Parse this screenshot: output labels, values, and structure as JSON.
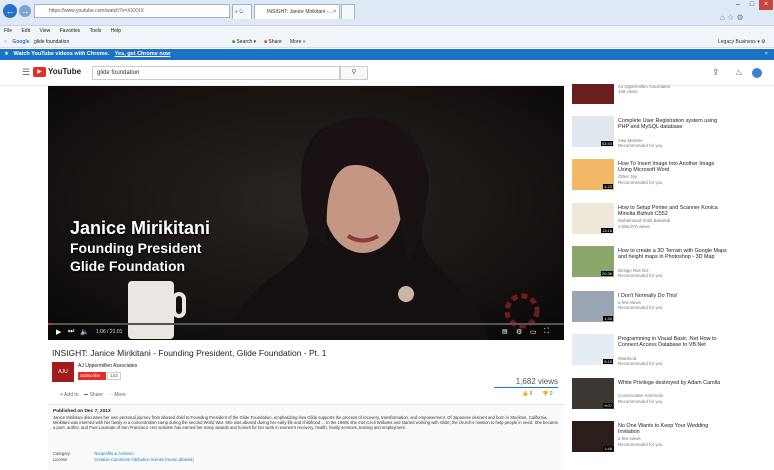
{
  "browser": {
    "url": "https://www.youtube.com/watch?v=XXXXX",
    "tab1_title": "INSIGHT: Janice Mirikitani -...",
    "menu": [
      "File",
      "Edit",
      "View",
      "Favorites",
      "Tools",
      "Help"
    ],
    "search_engine": "Google",
    "search_text": "glide foundation",
    "search_btn": "Search",
    "share_btn": "Share",
    "more_btn": "More",
    "signin": "Legacy Business"
  },
  "chrome_banner": {
    "text": "Watch YouTube videos with Chrome.",
    "link": "Yes, get Chrome now"
  },
  "youtube": {
    "logo": "YouTube",
    "search_value": "glide foundation"
  },
  "video": {
    "overlay_name": "Janice Mirikitani",
    "overlay_role1": "Founding President",
    "overlay_role2": "Glide Foundation",
    "time": "1:06 / 21:01",
    "title": "INSIGHT: Janice Mirikitani - Founding President, Glide Foundation - Pt. 1",
    "channel": "AJ Uppermillen Associates",
    "subscribe": "Subscribe",
    "sub_count": "103",
    "views": "1,682 views",
    "likes": "6",
    "dislikes": "0",
    "add_to": "Add to",
    "share": "Share",
    "more": "More",
    "published": "Published on Dec 7, 2013",
    "description": "Janice Mirikitani discusses her own personal journey from abused child to Founding President of the Glide Foundation, emphasizing how Glide supports the process of recovery, transformation, and empowerment. Of Japanese descent and born in Stockton, California, Mirikitani was interned with her family in a concentration camp during the second World War. She was abused during her early life and childhood ... In the 1960s she met Cecil Williams and started working with Glide; the church's mission to help people in need. She became a poet, author, and Poet Laureate of San Francisco. Her activism has earned her many awards and honors for her work in women's recovery, health, family services, training and employment.",
    "category_label": "Category",
    "category_value": "Nonprofits & Activism",
    "license_label": "License",
    "license_value": "Creative Commons Attribution license (reuse allowed)"
  },
  "sidebar": [
    {
      "title": "",
      "meta1": "AJ Uppermillen Associates",
      "meta2": "108 views",
      "dur": ""
    },
    {
      "title": "Complete User Registration system using PHP and MySQL database",
      "meta1": "Awa Melvine",
      "meta2": "Recommended for you",
      "dur": "53:43"
    },
    {
      "title": "How To Insert Image Into Another Image Using Microsoft Word",
      "meta1": "Other Jay",
      "meta2": "Recommended for you",
      "dur": "4:23"
    },
    {
      "title": "How to Setup Printer and Scanner Konica Minolta Bizhub C552",
      "meta1": "Muhammad Shafi Baswedi",
      "meta2": "2,056,870 views",
      "dur": "13:16"
    },
    {
      "title": "How to create a 3D Terrain with Google Maps and height maps in Photoshop - 3D Map",
      "meta1": "Design Ros Gis",
      "meta2": "Recommended for you",
      "dur": "20:36"
    },
    {
      "title": "I Don't Normally Do This!",
      "meta1": "a few views",
      "meta2": "Recommended for you",
      "dur": "1:40"
    },
    {
      "title": "Programming in Visual Basic .Net How to Connect Access Database to VB.Net",
      "meta1": "iWantcod",
      "meta2": "Recommended for you",
      "dur": "8:15"
    },
    {
      "title": "White Privilege destroyed by Adam Carolla",
      "meta1": "Conservative Americas",
      "meta2": "Recommended for you",
      "dur": "9:07"
    },
    {
      "title": "No One Wants to Keep Your Wedding Invitation",
      "meta1": "a few views",
      "meta2": "Recommended for you",
      "dur": "1:48"
    }
  ]
}
